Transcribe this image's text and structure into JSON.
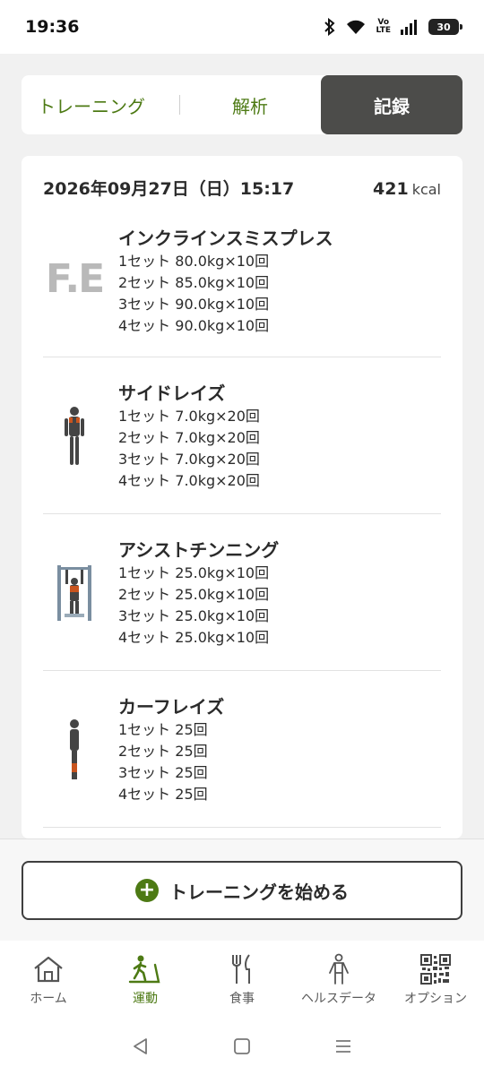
{
  "status": {
    "time": "19:36",
    "battery": "30",
    "volte_top": "Vo",
    "volte_bottom": "LTE"
  },
  "tabs": [
    {
      "label": "トレーニング",
      "active": false
    },
    {
      "label": "解析",
      "active": false
    },
    {
      "label": "記録",
      "active": true
    }
  ],
  "record": {
    "date": "2026年09月27日（日）15:17",
    "kcal_value": "421",
    "kcal_unit": "kcal",
    "exercises": [
      {
        "name": "インクラインスミスプレス",
        "thumb_icon": "fe-logo",
        "thumb_text": "F.E",
        "sets": [
          "1セット 80.0kg×10回",
          "2セット 85.0kg×10回",
          "3セット 90.0kg×10回",
          "4セット 90.0kg×10回"
        ]
      },
      {
        "name": "サイドレイズ",
        "thumb_icon": "side-raise-figure-icon",
        "sets": [
          "1セット 7.0kg×20回",
          "2セット 7.0kg×20回",
          "3セット 7.0kg×20回",
          "4セット 7.0kg×20回"
        ]
      },
      {
        "name": "アシストチンニング",
        "thumb_icon": "assisted-chinup-figure-icon",
        "sets": [
          "1セット 25.0kg×10回",
          "2セット 25.0kg×10回",
          "3セット 25.0kg×10回",
          "4セット 25.0kg×10回"
        ]
      },
      {
        "name": "カーフレイズ",
        "thumb_icon": "calf-raise-figure-icon",
        "sets": [
          "1セット 25回",
          "2セット 25回",
          "3セット 25回",
          "4セット 25回"
        ]
      }
    ]
  },
  "start_button": {
    "label": "トレーニングを始める"
  },
  "bottom_nav": [
    {
      "label": "ホーム",
      "icon": "home-icon",
      "active": false
    },
    {
      "label": "運動",
      "icon": "walking-icon",
      "active": true
    },
    {
      "label": "食事",
      "icon": "fork-knife-icon",
      "active": false
    },
    {
      "label": "ヘルスデータ",
      "icon": "person-icon",
      "active": false
    },
    {
      "label": "オプション",
      "icon": "qr-code-icon",
      "active": false
    }
  ],
  "colors": {
    "accent_green": "#4d7a14",
    "active_tab_bg": "#4c4c4a",
    "muscle_orange": "#c8541e"
  }
}
